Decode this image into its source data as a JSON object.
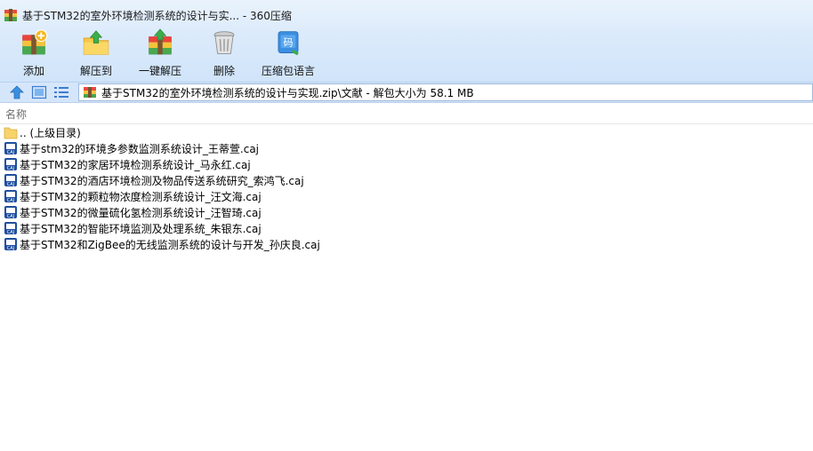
{
  "window": {
    "title": "基于STM32的室外环境检测系统的设计与实... - 360压缩"
  },
  "toolbar": {
    "items": [
      {
        "label": "添加",
        "icon": "add-archive-icon"
      },
      {
        "label": "解压到",
        "icon": "extract-to-icon"
      },
      {
        "label": "一键解压",
        "icon": "one-click-extract-icon"
      },
      {
        "label": "删除",
        "icon": "trash-can-icon"
      },
      {
        "label": "压缩包语言",
        "icon": "archive-language-icon"
      }
    ]
  },
  "address": {
    "path": "基于STM32的室外环境检测系统的设计与实现.zip\\文献 - 解包大小为 58.1 MB"
  },
  "columns": {
    "name": "名称"
  },
  "files": [
    {
      "name": ".. (上级目录)",
      "type": "parent-folder"
    },
    {
      "name": "基于stm32的环境多参数监测系统设计_王蒂萱.caj",
      "type": "caj"
    },
    {
      "name": "基于STM32的家居环境检测系统设计_马永红.caj",
      "type": "caj"
    },
    {
      "name": "基于STM32的酒店环境检测及物品传送系统研究_索鸿飞.caj",
      "type": "caj"
    },
    {
      "name": "基于STM32的颗粒物浓度检测系统设计_汪文海.caj",
      "type": "caj"
    },
    {
      "name": "基于STM32的微量硫化氢检测系统设计_汪智琦.caj",
      "type": "caj"
    },
    {
      "name": "基于STM32的智能环境监测及处理系统_朱银东.caj",
      "type": "caj"
    },
    {
      "name": "基于STM32和ZigBee的无线监测系统的设计与开发_孙庆良.caj",
      "type": "caj"
    }
  ]
}
